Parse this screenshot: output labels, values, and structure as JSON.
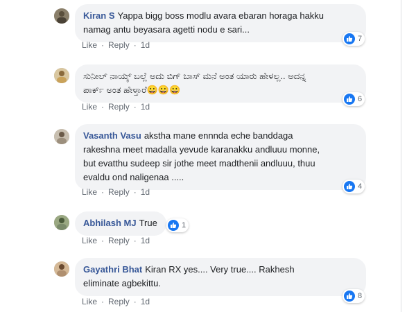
{
  "comments": [
    {
      "author": "Kiran S",
      "lines": [
        "Yappa bigg boss modlu avara ebaran horaga hakku",
        "namag antu beyasara agetti nodu e sari..."
      ],
      "likes": "7",
      "actions": {
        "like": "Like",
        "reply": "Reply",
        "time": "1d"
      },
      "avatar_color": "#8a7f6a"
    },
    {
      "author": "",
      "lines": [
        "ಸುನೀಲ್ ನಾಯ್ಕ್ ಬಲ್ಲೆ ಅದು ಬಿಗ್ ಬಾಸ್ ಮನೆ ಅಂತ ಯಾರು ಹೇಳಲ್ಲ.. ಅದನ್ನ",
        "ಪಾರ್ಕ್ ಅಂತ ಹೇಳ್ತಾರೆ😀😀😀"
      ],
      "likes": "6",
      "actions": {
        "like": "Like",
        "reply": "Reply",
        "time": "1d"
      },
      "avatar_color": "#c9a25a"
    },
    {
      "author": "Vasanth Vasu",
      "lines": [
        "akstha mane ennnda eche banddaga",
        "rakeshna meet madalla yevude karanakku andluuu monne,",
        "but evatthu sudeep sir jothe meet madthenii andluuu, thuu",
        "evaldu ond naligenaa ....."
      ],
      "likes": "4",
      "actions": {
        "like": "Like",
        "reply": "Reply",
        "time": "1d"
      },
      "avatar_color": "#9c8f7d"
    },
    {
      "author": "Abhilash MJ",
      "lines": [
        "True"
      ],
      "likes": "1",
      "actions": {
        "like": "Like",
        "reply": "Reply",
        "time": "1d"
      },
      "avatar_color": "#7a8a6a"
    },
    {
      "author": "Gayathri Bhat",
      "lines": [
        "Kiran RX yes.... Very true.... Rakhesh",
        "eliminate agbekittu."
      ],
      "likes": "8",
      "actions": {
        "like": "Like",
        "reply": "Reply",
        "time": "1d"
      },
      "avatar_color": "#b09070"
    }
  ],
  "action_separator": "·",
  "like_icon": "thumbs-up-icon",
  "accent": "#385898"
}
